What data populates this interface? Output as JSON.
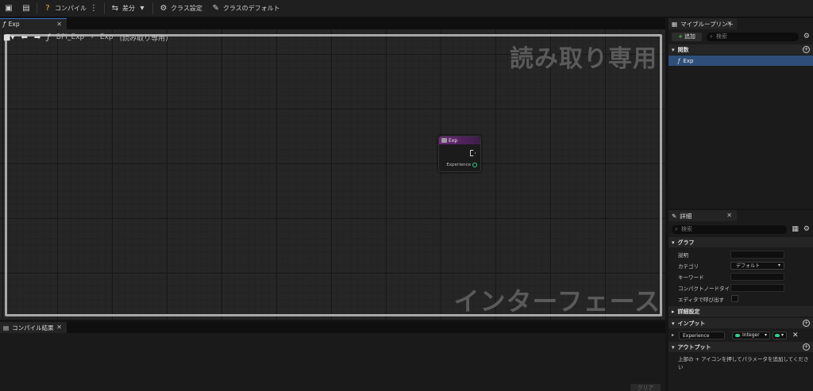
{
  "toolbar": {
    "compile_label": "コンパイル",
    "diff_label": "差分",
    "class_settings_label": "クラス設定",
    "class_defaults_label": "クラスのデフォルト"
  },
  "graph_tab": {
    "label": "Exp"
  },
  "breadcrumb": {
    "path": "BPI_Exp",
    "function": "Exp",
    "readonly": "(読み取り専用)"
  },
  "watermarks": {
    "top": "読み取り専用",
    "bottom": "インターフェース"
  },
  "node": {
    "title": "Exp",
    "param_label": "Experience"
  },
  "compile_tab": {
    "label": "コンパイル結果"
  },
  "clear_button": "クリア",
  "my_blueprint": {
    "tab_label": "マイブループリント",
    "add_label": "追加",
    "search_placeholder": "検索",
    "section_functions": "関数",
    "function_item": "Exp"
  },
  "details": {
    "tab_label": "詳細",
    "search_placeholder": "検索",
    "section_graph": "グラフ",
    "prop_description": "説明",
    "prop_category": "カテゴリ",
    "category_value": "デフォルト",
    "prop_keywords": "キーワード",
    "prop_compact_title": "コンパクトノードタイトル",
    "prop_call_in_editor": "エディタで呼び出す",
    "section_advanced": "詳細設定",
    "section_inputs": "インプット",
    "input_name": "Experience",
    "input_type": "Integer",
    "section_outputs": "アウトプット",
    "outputs_hint": "上部の + アイコンを押してパラメータを追加してください"
  }
}
